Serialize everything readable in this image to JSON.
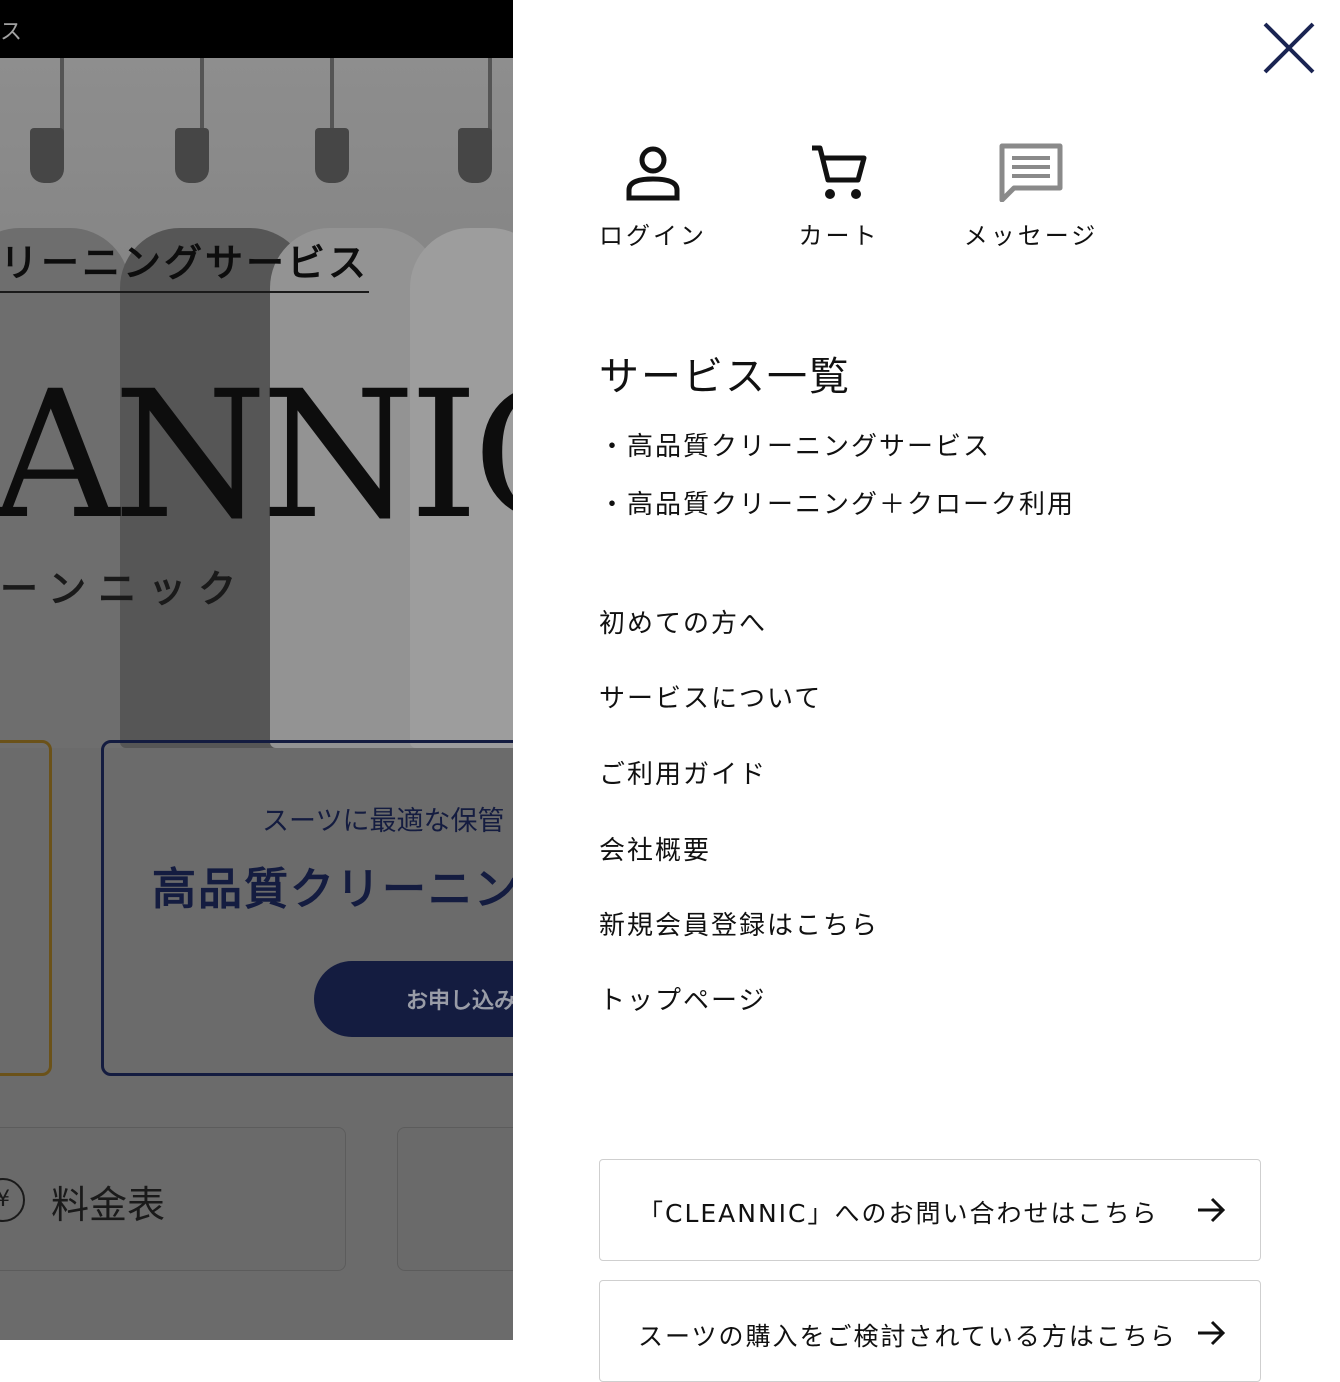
{
  "background": {
    "topbar_text": "ス",
    "hero_subtitle": "リーニングサービス",
    "hero_logo": "ANNIC",
    "hero_kana": "ーンニック",
    "card_subtitle": "スーツに最適な保管",
    "card_title": "高品質クリーニン",
    "card_button": "お申し込み",
    "price_label": "料金表",
    "yen_symbol": "¥"
  },
  "drawer": {
    "quick_links": {
      "login": "ログイン",
      "cart": "カート",
      "message": "メッセージ"
    },
    "services": {
      "title": "サービス一覧",
      "items": [
        "・高品質クリーニングサービス",
        "・高品質クリーニング＋クローク利用"
      ]
    },
    "nav": [
      "初めての方へ",
      "サービスについて",
      "ご利用ガイド",
      "会社概要",
      "新規会員登録はこちら",
      "トップページ"
    ],
    "links": [
      "「CLEANNIC」へのお問い合わせはこちら",
      "スーツの購入をご検討されている方はこちら"
    ]
  },
  "colors": {
    "navy": "#1a2452",
    "gold_border": "#8a6a20",
    "icon_gray": "#8a8a8a"
  },
  "icons": [
    "close-icon",
    "person-icon",
    "cart-icon",
    "message-icon",
    "arrow-right-icon",
    "yen-icon"
  ]
}
